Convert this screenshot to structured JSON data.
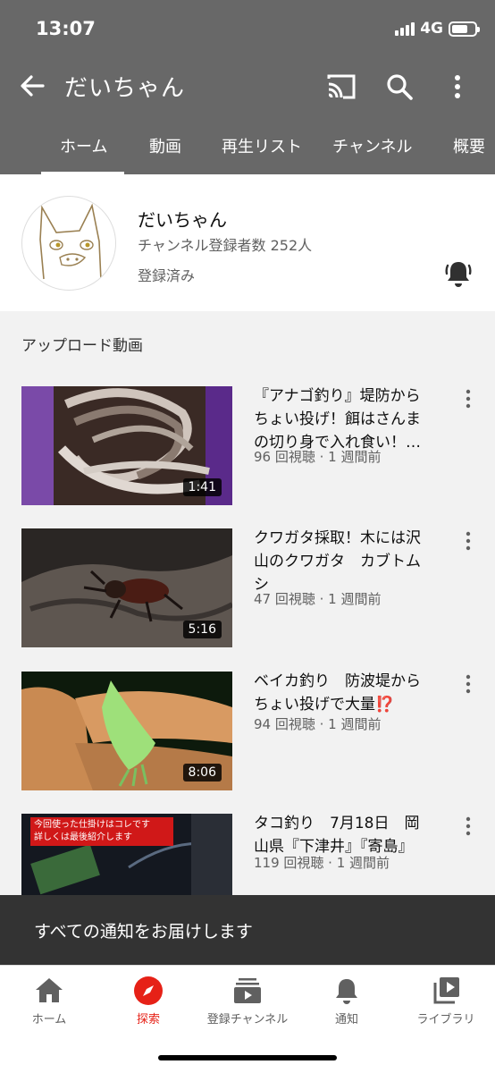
{
  "status_bar": {
    "time": "13:07",
    "network": "4G"
  },
  "app_bar": {
    "title": "だいちゃん",
    "icons": [
      "back-arrow-icon",
      "cast-icon",
      "search-icon",
      "more-vertical-icon"
    ]
  },
  "tabs": [
    {
      "label": "ホーム",
      "selected": true
    },
    {
      "label": "動画",
      "selected": false
    },
    {
      "label": "再生リスト",
      "selected": false
    },
    {
      "label": "チャンネル",
      "selected": false
    },
    {
      "label": "概要",
      "selected": false
    }
  ],
  "channel": {
    "name": "だいちゃん",
    "subscribers": "チャンネル登録者数 252人",
    "subscription_status": "登録済み",
    "bell_icon": "notification-bell-icon"
  },
  "section": {
    "title": "アップロード動画"
  },
  "videos": [
    {
      "title": "『アナゴ釣り』堤防からちょい投げ！餌はさんまの切り身で入れ食い！…",
      "meta": "96 回視聴 · 1 週間前",
      "duration": "1:41"
    },
    {
      "title": "クワガタ採取！木には沢山のクワガタ　カブトムシ",
      "meta": "47 回視聴 · 1 週間前",
      "duration": "5:16"
    },
    {
      "title": "ベイカ釣り　防波堤からちょい投げで大量⁉️",
      "meta": "94 回視聴 · 1 週間前",
      "duration": "8:06"
    },
    {
      "title": "タコ釣り　7月18日　岡山県『下津井』『寄島』",
      "meta": "119 回視聴 · 1 週間前",
      "duration": "",
      "thumb_caption_1": "今回使った仕掛けはコレです",
      "thumb_caption_2": "詳しくは最後紹介します"
    }
  ],
  "snackbar": {
    "text": "すべての通知をお届けします"
  },
  "bottom_nav": [
    {
      "label": "ホーム",
      "icon": "home-icon",
      "active": false
    },
    {
      "label": "探索",
      "icon": "explore-compass-icon",
      "active": true
    },
    {
      "label": "登録チャンネル",
      "icon": "subscriptions-icon",
      "active": false
    },
    {
      "label": "通知",
      "icon": "notification-bell-icon",
      "active": false
    },
    {
      "label": "ライブラリ",
      "icon": "library-icon",
      "active": false
    }
  ],
  "colors": {
    "app_bar": "#686868",
    "accent": "#e62117",
    "snackbar": "#333333"
  }
}
